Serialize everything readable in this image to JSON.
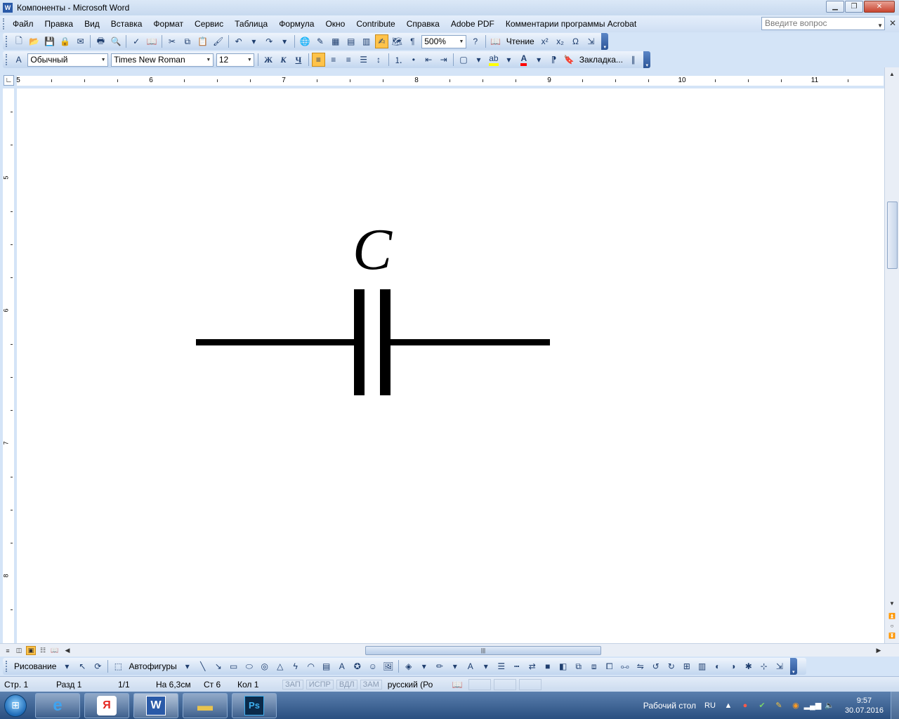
{
  "window": {
    "title": "Компоненты - Microsoft Word",
    "app_icon": "word-icon"
  },
  "menu": {
    "items": [
      "Файл",
      "Правка",
      "Вид",
      "Вставка",
      "Формат",
      "Сервис",
      "Таблица",
      "Формула",
      "Окно",
      "Contribute",
      "Справка",
      "Adobe PDF",
      "Комментарии программы Acrobat"
    ],
    "ask_placeholder": "Введите вопрос"
  },
  "standard_toolbar": {
    "zoom": "500%",
    "reading_label": "Чтение",
    "superscript": "x²",
    "subscript": "x₂",
    "omega": "Ω"
  },
  "format_toolbar": {
    "style": "Обычный",
    "font": "Times New Roman",
    "size": "12",
    "bold": "Ж",
    "italic": "К",
    "underline": "Ч",
    "bookmark": "Закладка...",
    "highlight_color": "#ffff00",
    "font_color": "#ff0000"
  },
  "ruler": {
    "h_labels": [
      "5",
      "6",
      "7",
      "8",
      "9",
      "10",
      "11"
    ],
    "v_labels": [
      "5",
      "6",
      "7",
      "8"
    ]
  },
  "document": {
    "capacitor_label": "C",
    "schematic_color": "#000000"
  },
  "drawing_toolbar": {
    "drawing_label": "Рисование",
    "autoshapes_label": "Автофигуры"
  },
  "status": {
    "page": "Стр. 1",
    "section": "Разд 1",
    "pages": "1/1",
    "at": "На 6,3см",
    "line": "Ст 6",
    "col": "Кол 1",
    "rec": "ЗАП",
    "trk": "ИСПР",
    "ext": "ВДЛ",
    "ovr": "ЗАМ",
    "language": "русский (Ро"
  },
  "taskbar": {
    "desktop_label": "Рабочий стол",
    "lang": "RU",
    "time": "9:57",
    "date": "30.07.2016",
    "apps": [
      "internet-explorer-icon",
      "yandex-browser-icon",
      "word-icon",
      "file-explorer-icon",
      "photoshop-icon"
    ]
  }
}
